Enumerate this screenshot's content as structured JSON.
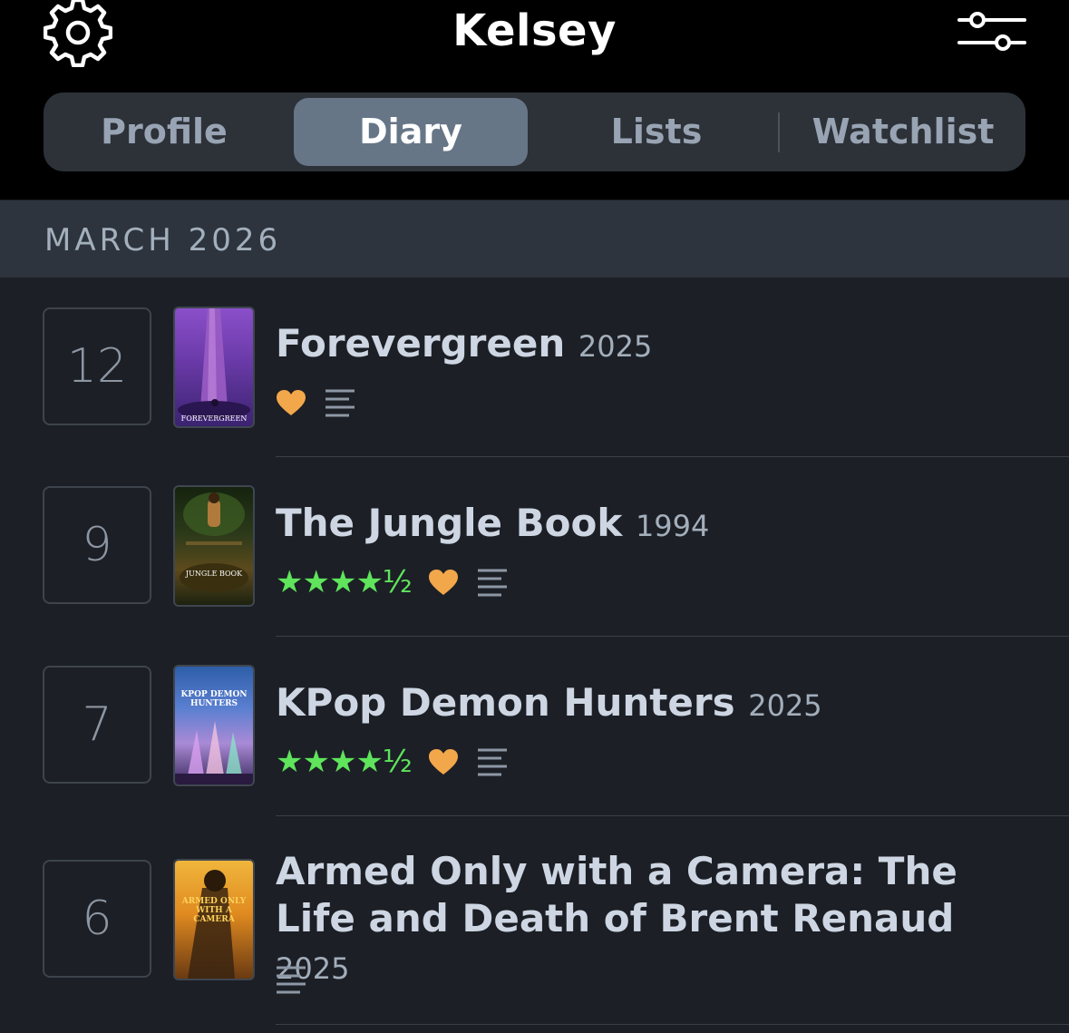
{
  "header": {
    "title": "Kelsey",
    "settings_icon": "gear-icon",
    "filter_icon": "sliders-icon"
  },
  "tabs": [
    {
      "label": "Profile",
      "active": false
    },
    {
      "label": "Diary",
      "active": true
    },
    {
      "label": "Lists",
      "active": false
    },
    {
      "label": "Watchlist",
      "active": false
    }
  ],
  "month": "MARCH 2026",
  "colors": {
    "accent_star": "#5fe45c",
    "heart": "#f2a74a",
    "active_tab": "#667687",
    "background": "#1c1f25"
  },
  "entries": [
    {
      "day": "12",
      "title": "Forevergreen",
      "year": "2025",
      "stars": "",
      "liked": true,
      "has_review": true,
      "poster_caption": "FOREVERGREEN"
    },
    {
      "day": "9",
      "title": "The Jungle Book",
      "year": "1994",
      "stars": "★★★★½",
      "rating": 4.5,
      "liked": true,
      "has_review": true,
      "poster_caption": "JUNGLE BOOK"
    },
    {
      "day": "7",
      "title": "KPop Demon Hunters",
      "year": "2025",
      "stars": "★★★★½",
      "rating": 4.5,
      "liked": true,
      "has_review": true,
      "poster_caption": "KPOP DEMON HUNTERS"
    },
    {
      "day": "6",
      "title": "Armed Only with a Camera: The Life and Death of Brent Renaud",
      "year": "2025",
      "stars": "",
      "liked": false,
      "has_review": true,
      "poster_caption": "ARMED ONLY WITH A CAMERA"
    }
  ]
}
